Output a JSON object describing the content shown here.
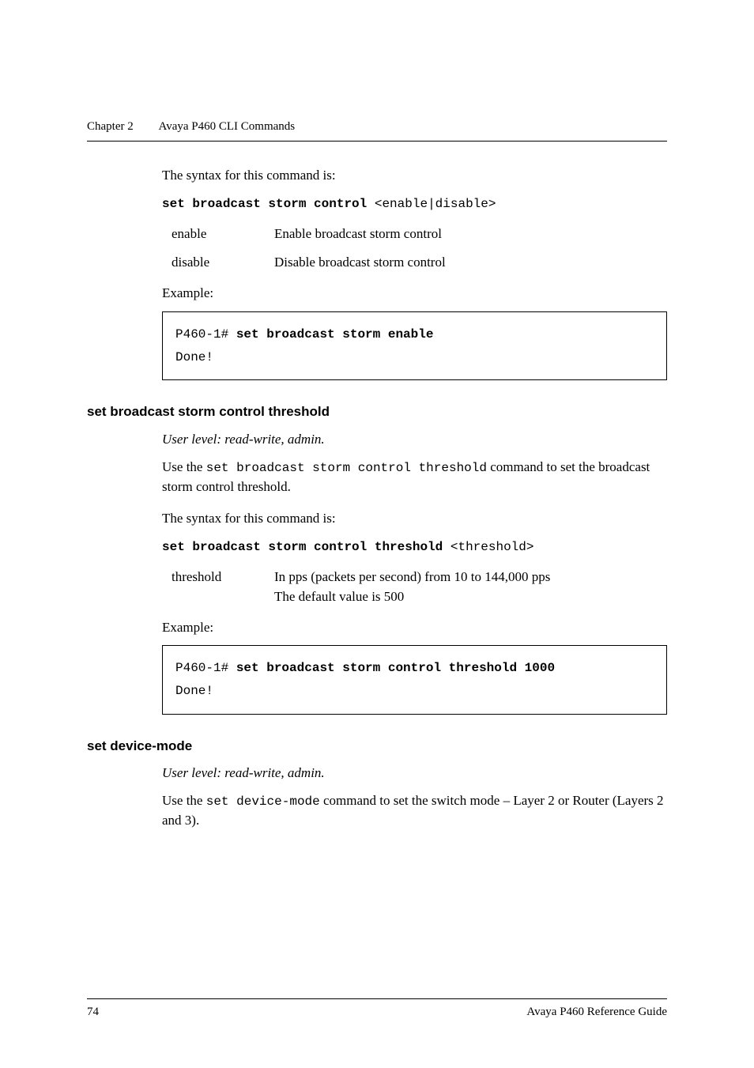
{
  "header": {
    "chapter": "Chapter 2",
    "title": "Avaya P460 CLI Commands"
  },
  "section1": {
    "syntax_label": "The syntax for this command is:",
    "syntax_cmd_bold": "set broadcast storm control",
    "syntax_cmd_arg": " <enable|disable>",
    "params": [
      {
        "name": "enable",
        "desc": "Enable broadcast storm control"
      },
      {
        "name": "disable",
        "desc": "Disable broadcast storm control"
      }
    ],
    "example_label": "Example:",
    "example_prompt": "P460-1#",
    "example_cmd": " set broadcast storm enable",
    "example_out": "Done!"
  },
  "section2": {
    "heading": "set broadcast storm control threshold",
    "user_level": "User level: read-write, admin.",
    "intro_pre": "Use the ",
    "intro_cmd": "set broadcast storm control threshold",
    "intro_post": " command to set the broadcast storm control threshold.",
    "syntax_label": "The syntax for this command is:",
    "syntax_cmd_bold": "set broadcast storm control threshold",
    "syntax_cmd_arg": " <threshold>",
    "params": [
      {
        "name": "threshold",
        "desc1": "In pps (packets per second) from 10 to 144,000 pps",
        "desc2": "The default value is 500"
      }
    ],
    "example_label": "Example:",
    "example_prompt": "P460-1#",
    "example_cmd": " set broadcast storm control threshold 1000",
    "example_out": "Done!"
  },
  "section3": {
    "heading": "set device-mode",
    "user_level": "User level: read-write, admin.",
    "intro_pre": "Use the ",
    "intro_cmd": "set device-mode",
    "intro_post": " command to set the switch mode – Layer 2 or Router (Layers 2 and 3)."
  },
  "footer": {
    "page_num": "74",
    "doc_title": "Avaya P460 Reference Guide"
  }
}
